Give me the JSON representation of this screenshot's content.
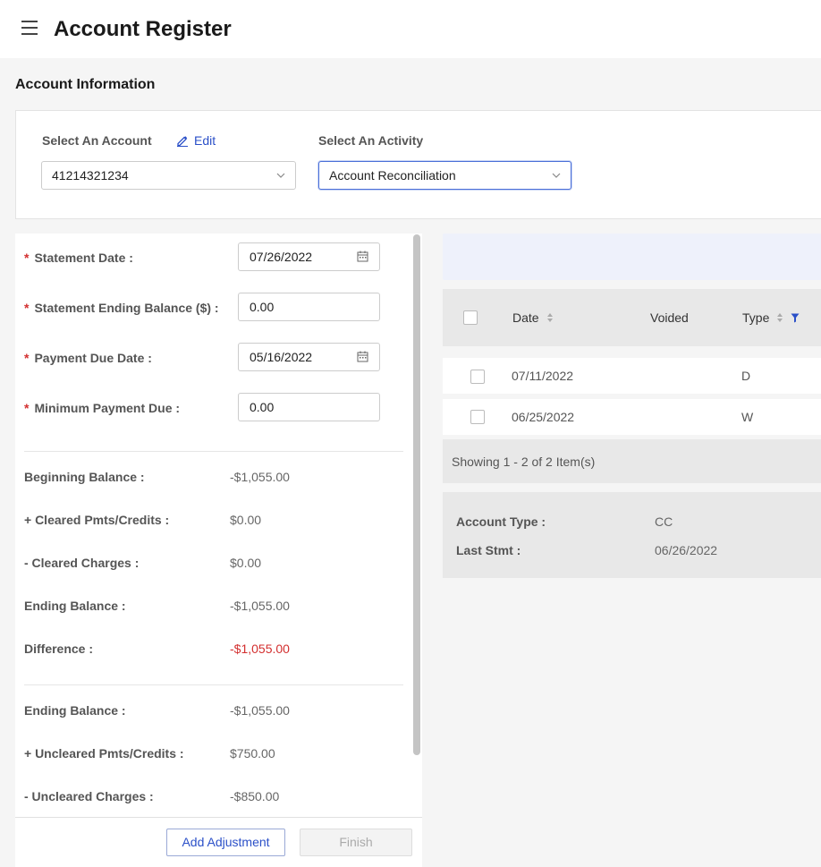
{
  "header": {
    "title": "Account Register"
  },
  "section": {
    "title": "Account Information"
  },
  "account_select": {
    "label": "Select An Account",
    "edit_label": "Edit",
    "value": "41214321234",
    "activity_label": "Select An Activity",
    "activity_value": "Account Reconciliation"
  },
  "form": {
    "statement_date_label": "Statement Date",
    "statement_date": "07/26/2022",
    "ending_balance_label": "Statement Ending Balance ($)",
    "ending_balance": "0.00",
    "payment_due_label": "Payment Due Date",
    "payment_due": "05/16/2022",
    "min_payment_label": "Minimum Payment Due",
    "min_payment": "0.00"
  },
  "summary": [
    {
      "label": "Beginning Balance",
      "value": "-$1,055.00"
    },
    {
      "label": "+ Cleared Pmts/Credits",
      "value": "$0.00"
    },
    {
      "label": "- Cleared Charges",
      "value": "$0.00"
    },
    {
      "label": "Ending Balance",
      "value": "-$1,055.00"
    },
    {
      "label": "Difference",
      "value": "-$1,055.00"
    }
  ],
  "summary2": [
    {
      "label": "Ending Balance",
      "value": "-$1,055.00"
    },
    {
      "label": "+ Uncleared Pmts/Credits",
      "value": "$750.00"
    },
    {
      "label": "- Uncleared Charges",
      "value": "-$850.00"
    }
  ],
  "buttons": {
    "add_adjustment": "Add Adjustment",
    "finish": "Finish"
  },
  "grid": {
    "columns": {
      "date": "Date",
      "voided": "Voided",
      "type": "Type"
    },
    "rows": [
      {
        "date": "07/11/2022",
        "voided": "",
        "type": "D"
      },
      {
        "date": "06/25/2022",
        "voided": "",
        "type": "W"
      }
    ],
    "footer": "Showing 1 - 2 of 2 Item(s)"
  },
  "details": {
    "account_type_label": "Account Type",
    "account_type": "CC",
    "last_stmt_label": "Last Stmt",
    "last_stmt": "06/26/2022"
  },
  "colors": {
    "accent": "#2b50c8",
    "negative": "#d32f2f",
    "required": "#d32f2f"
  }
}
